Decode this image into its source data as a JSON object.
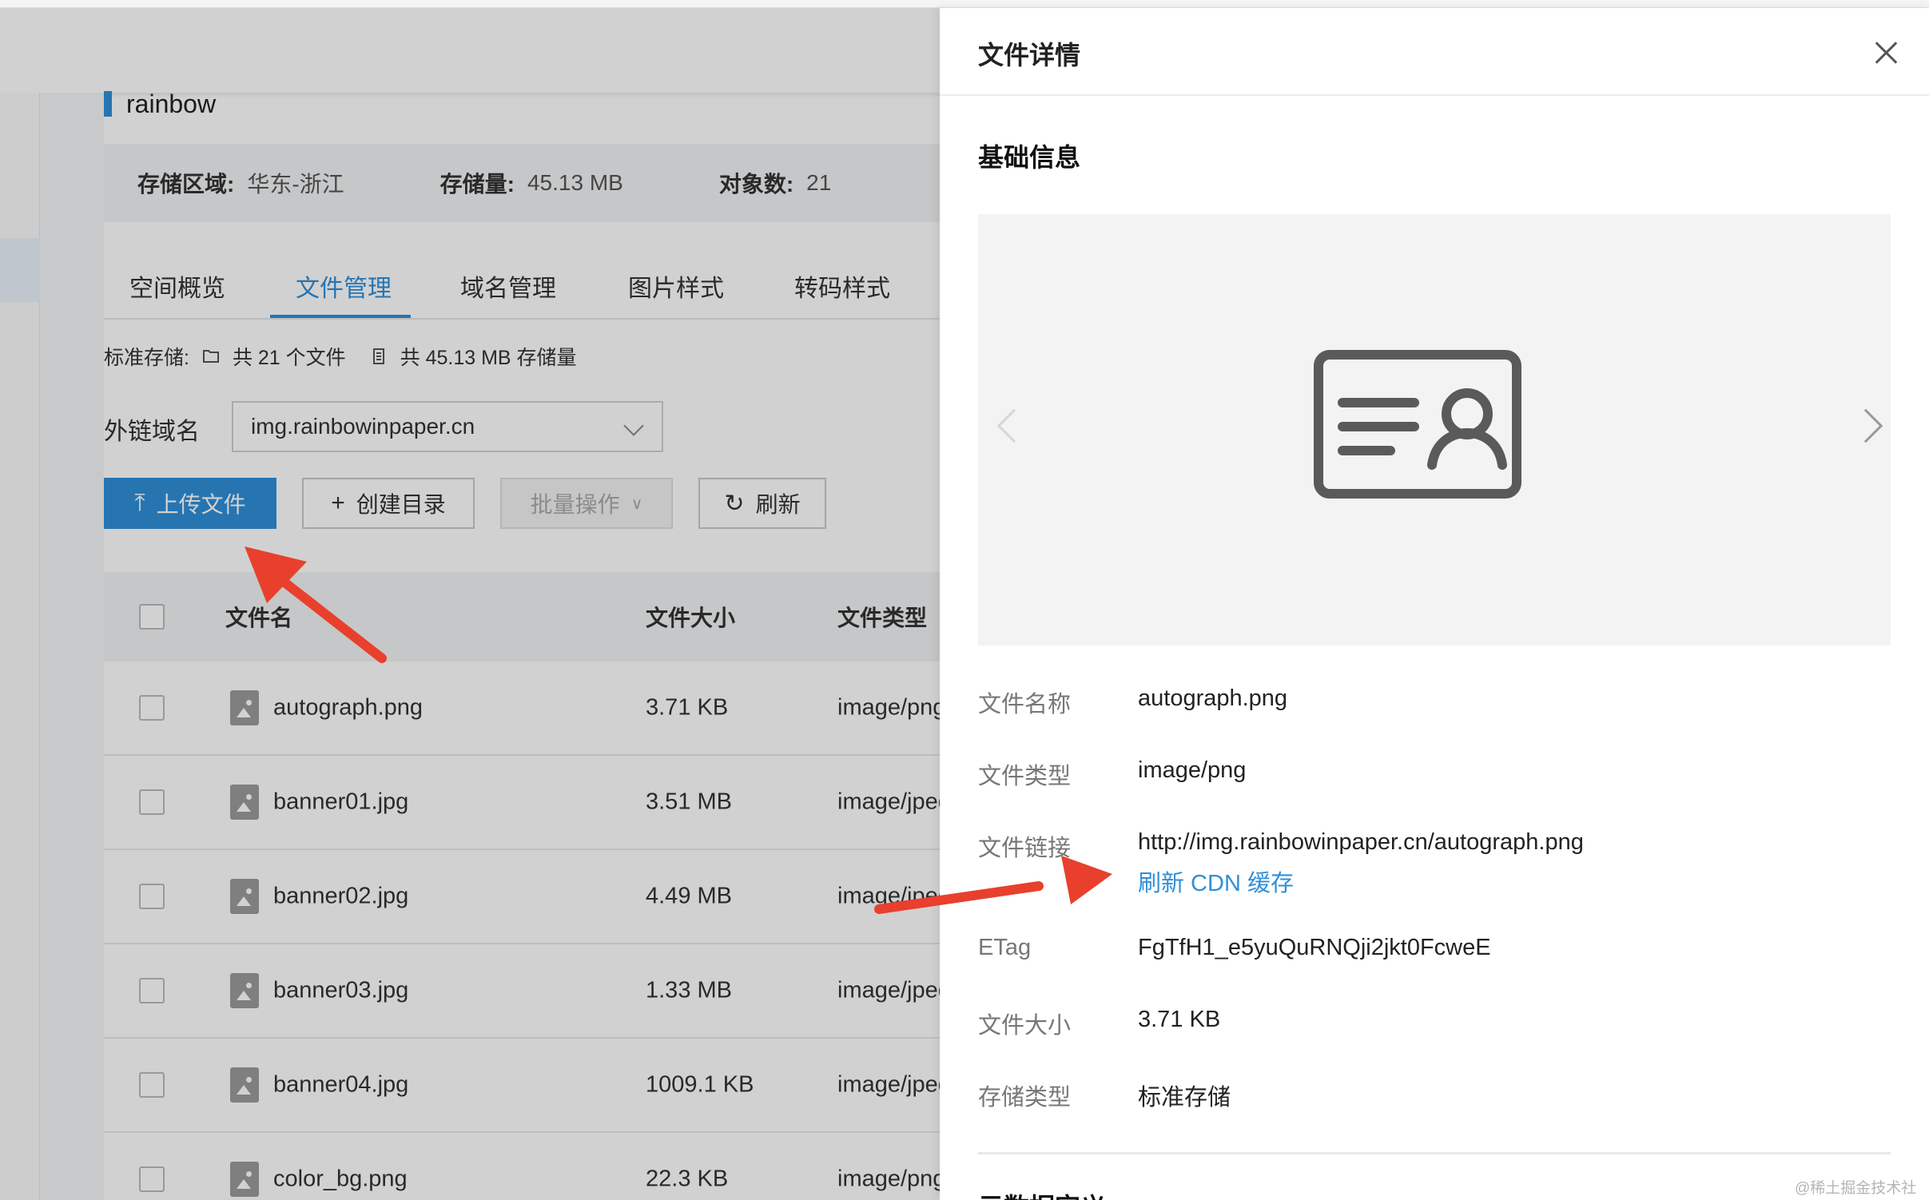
{
  "bucket": {
    "name": "rainbow",
    "region_label": "存储区域:",
    "region_value": "华东-浙江",
    "storage_label": "存储量:",
    "storage_value": "45.13 MB",
    "objects_label": "对象数:",
    "objects_value": "21"
  },
  "tabs": [
    {
      "label": "空间概览",
      "active": false
    },
    {
      "label": "文件管理",
      "active": true
    },
    {
      "label": "域名管理",
      "active": false
    },
    {
      "label": "图片样式",
      "active": false
    },
    {
      "label": "转码样式",
      "active": false
    }
  ],
  "stats": {
    "type_label": "标准存储:",
    "file_count": "共 21 个文件",
    "storage_total": "共 45.13 MB 存储量"
  },
  "domain": {
    "label": "外链域名",
    "selected": "img.rainbowinpaper.cn"
  },
  "toolbar": {
    "upload": "上传文件",
    "mkdir": "创建目录",
    "batch": "批量操作",
    "refresh": "刷新"
  },
  "table": {
    "headers": [
      "文件名",
      "文件大小",
      "文件类型"
    ],
    "rows": [
      {
        "name": "autograph.png",
        "size": "3.71 KB",
        "type": "image/png"
      },
      {
        "name": "banner01.jpg",
        "size": "3.51 MB",
        "type": "image/jpeg"
      },
      {
        "name": "banner02.jpg",
        "size": "4.49 MB",
        "type": "image/jpeg"
      },
      {
        "name": "banner03.jpg",
        "size": "1.33 MB",
        "type": "image/jpeg"
      },
      {
        "name": "banner04.jpg",
        "size": "1009.1 KB",
        "type": "image/jpeg"
      },
      {
        "name": "color_bg.png",
        "size": "22.3 KB",
        "type": "image/png"
      }
    ]
  },
  "drawer": {
    "title": "文件详情",
    "section_basic": "基础信息",
    "fields": {
      "name_label": "文件名称",
      "name_value": "autograph.png",
      "type_label": "文件类型",
      "type_value": "image/png",
      "link_label": "文件链接",
      "link_value": "http://img.rainbowinpaper.cn/autograph.png",
      "refresh_cdn": "刷新 CDN 缓存",
      "etag_label": "ETag",
      "etag_value": "FgTfH1_e5yuQuRNQji2jkt0FcweE",
      "size_label": "文件大小",
      "size_value": "3.71 KB",
      "storage_label": "存储类型",
      "storage_value": "标准存储"
    },
    "section_meta": "元数据定义"
  },
  "watermark": "@稀土掘金技术社区",
  "colors": {
    "accent": "#2f8fd8",
    "arrow": "#e8402c"
  }
}
